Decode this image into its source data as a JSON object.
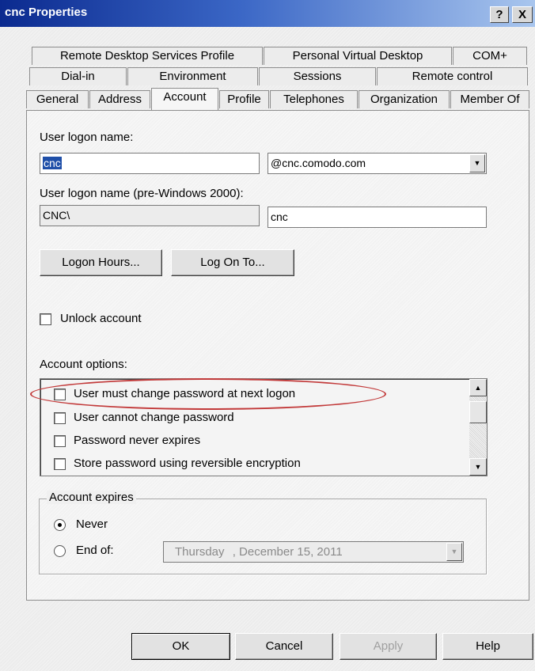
{
  "window": {
    "title": "cnc Properties",
    "help_button": "?",
    "close_button": "X"
  },
  "tabs": {
    "row1": [
      "Remote Desktop Services Profile",
      "Personal Virtual Desktop",
      "COM+"
    ],
    "row2": [
      "Dial-in",
      "Environment",
      "Sessions",
      "Remote control"
    ],
    "row3": [
      "General",
      "Address",
      "Account",
      "Profile",
      "Telephones",
      "Organization",
      "Member Of"
    ],
    "active": "Account"
  },
  "account": {
    "logon_name_label": "User logon name:",
    "logon_name_value": "cnc",
    "domain_value": "@cnc.comodo.com",
    "pre2000_label": "User logon name (pre-Windows 2000):",
    "pre2000_domain": "CNC\\",
    "pre2000_name": "cnc",
    "logon_hours_button": "Logon Hours...",
    "log_on_to_button": "Log On To...",
    "unlock_label": "Unlock account",
    "options_label": "Account options:",
    "options": [
      "User must change password at next logon",
      "User cannot change password",
      "Password never expires",
      "Store password using reversible encryption"
    ],
    "expires_group_label": "Account expires",
    "never_label": "Never",
    "end_of_label": "End of:",
    "end_of_date_day": "Thursday",
    "end_of_date_rest": ", December 15, 2011"
  },
  "footer": {
    "ok": "OK",
    "cancel": "Cancel",
    "apply": "Apply",
    "help": "Help"
  },
  "colors": {
    "highlight_ellipse": "#c23a3a",
    "selection": "#1f4fa8",
    "titlebar_start": "#0b2a8f"
  }
}
